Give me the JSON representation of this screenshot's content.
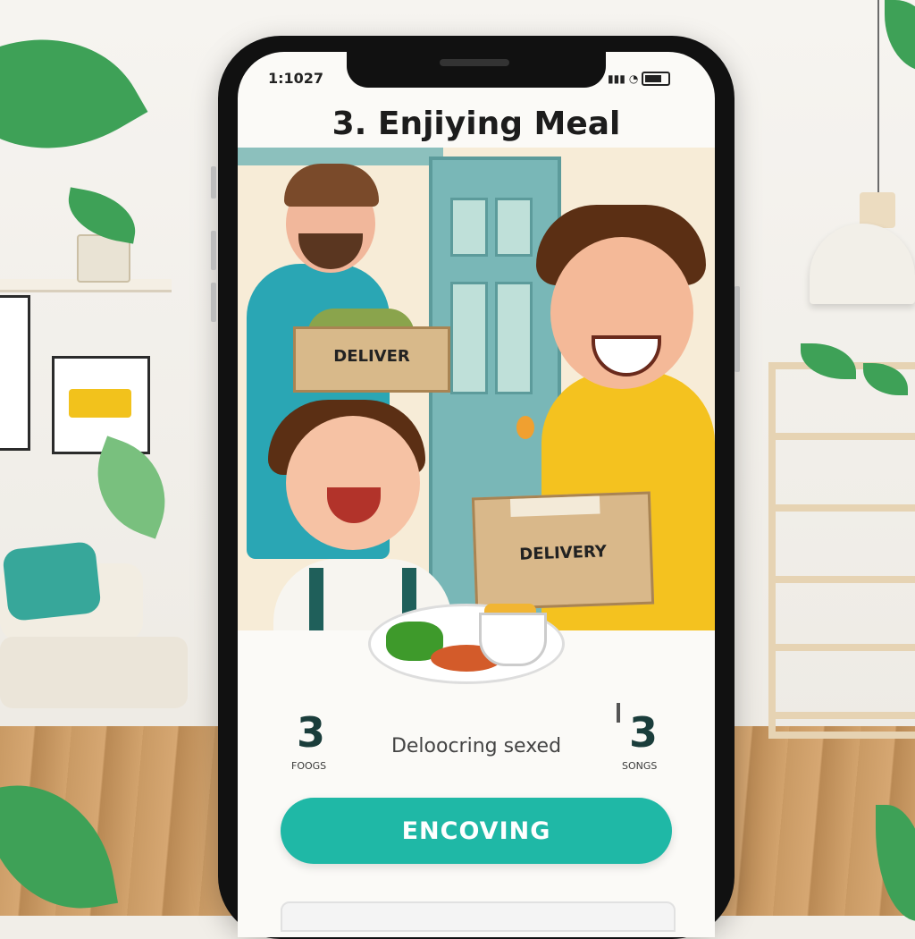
{
  "status_bar": {
    "time": "1:1027",
    "signal_icon": "signal-icon",
    "wifi_icon": "wifi-icon",
    "battery_icon": "battery-icon"
  },
  "header": {
    "title": "3. Enjiying Meal"
  },
  "illustration": {
    "box_label_1": "DELIVER",
    "box_label_2": "DELIVERY"
  },
  "stats": {
    "left_value": "3",
    "left_label": "FOOGS",
    "center_label": "Deloocring sexed",
    "right_value": "3",
    "right_label": "SONGS"
  },
  "cta": {
    "label": "ENCOVING"
  },
  "colors": {
    "accent": "#1fb8a6",
    "phone_frame": "#111111",
    "shirt_yellow": "#f4c21f",
    "shirt_teal": "#2aa6b4"
  }
}
